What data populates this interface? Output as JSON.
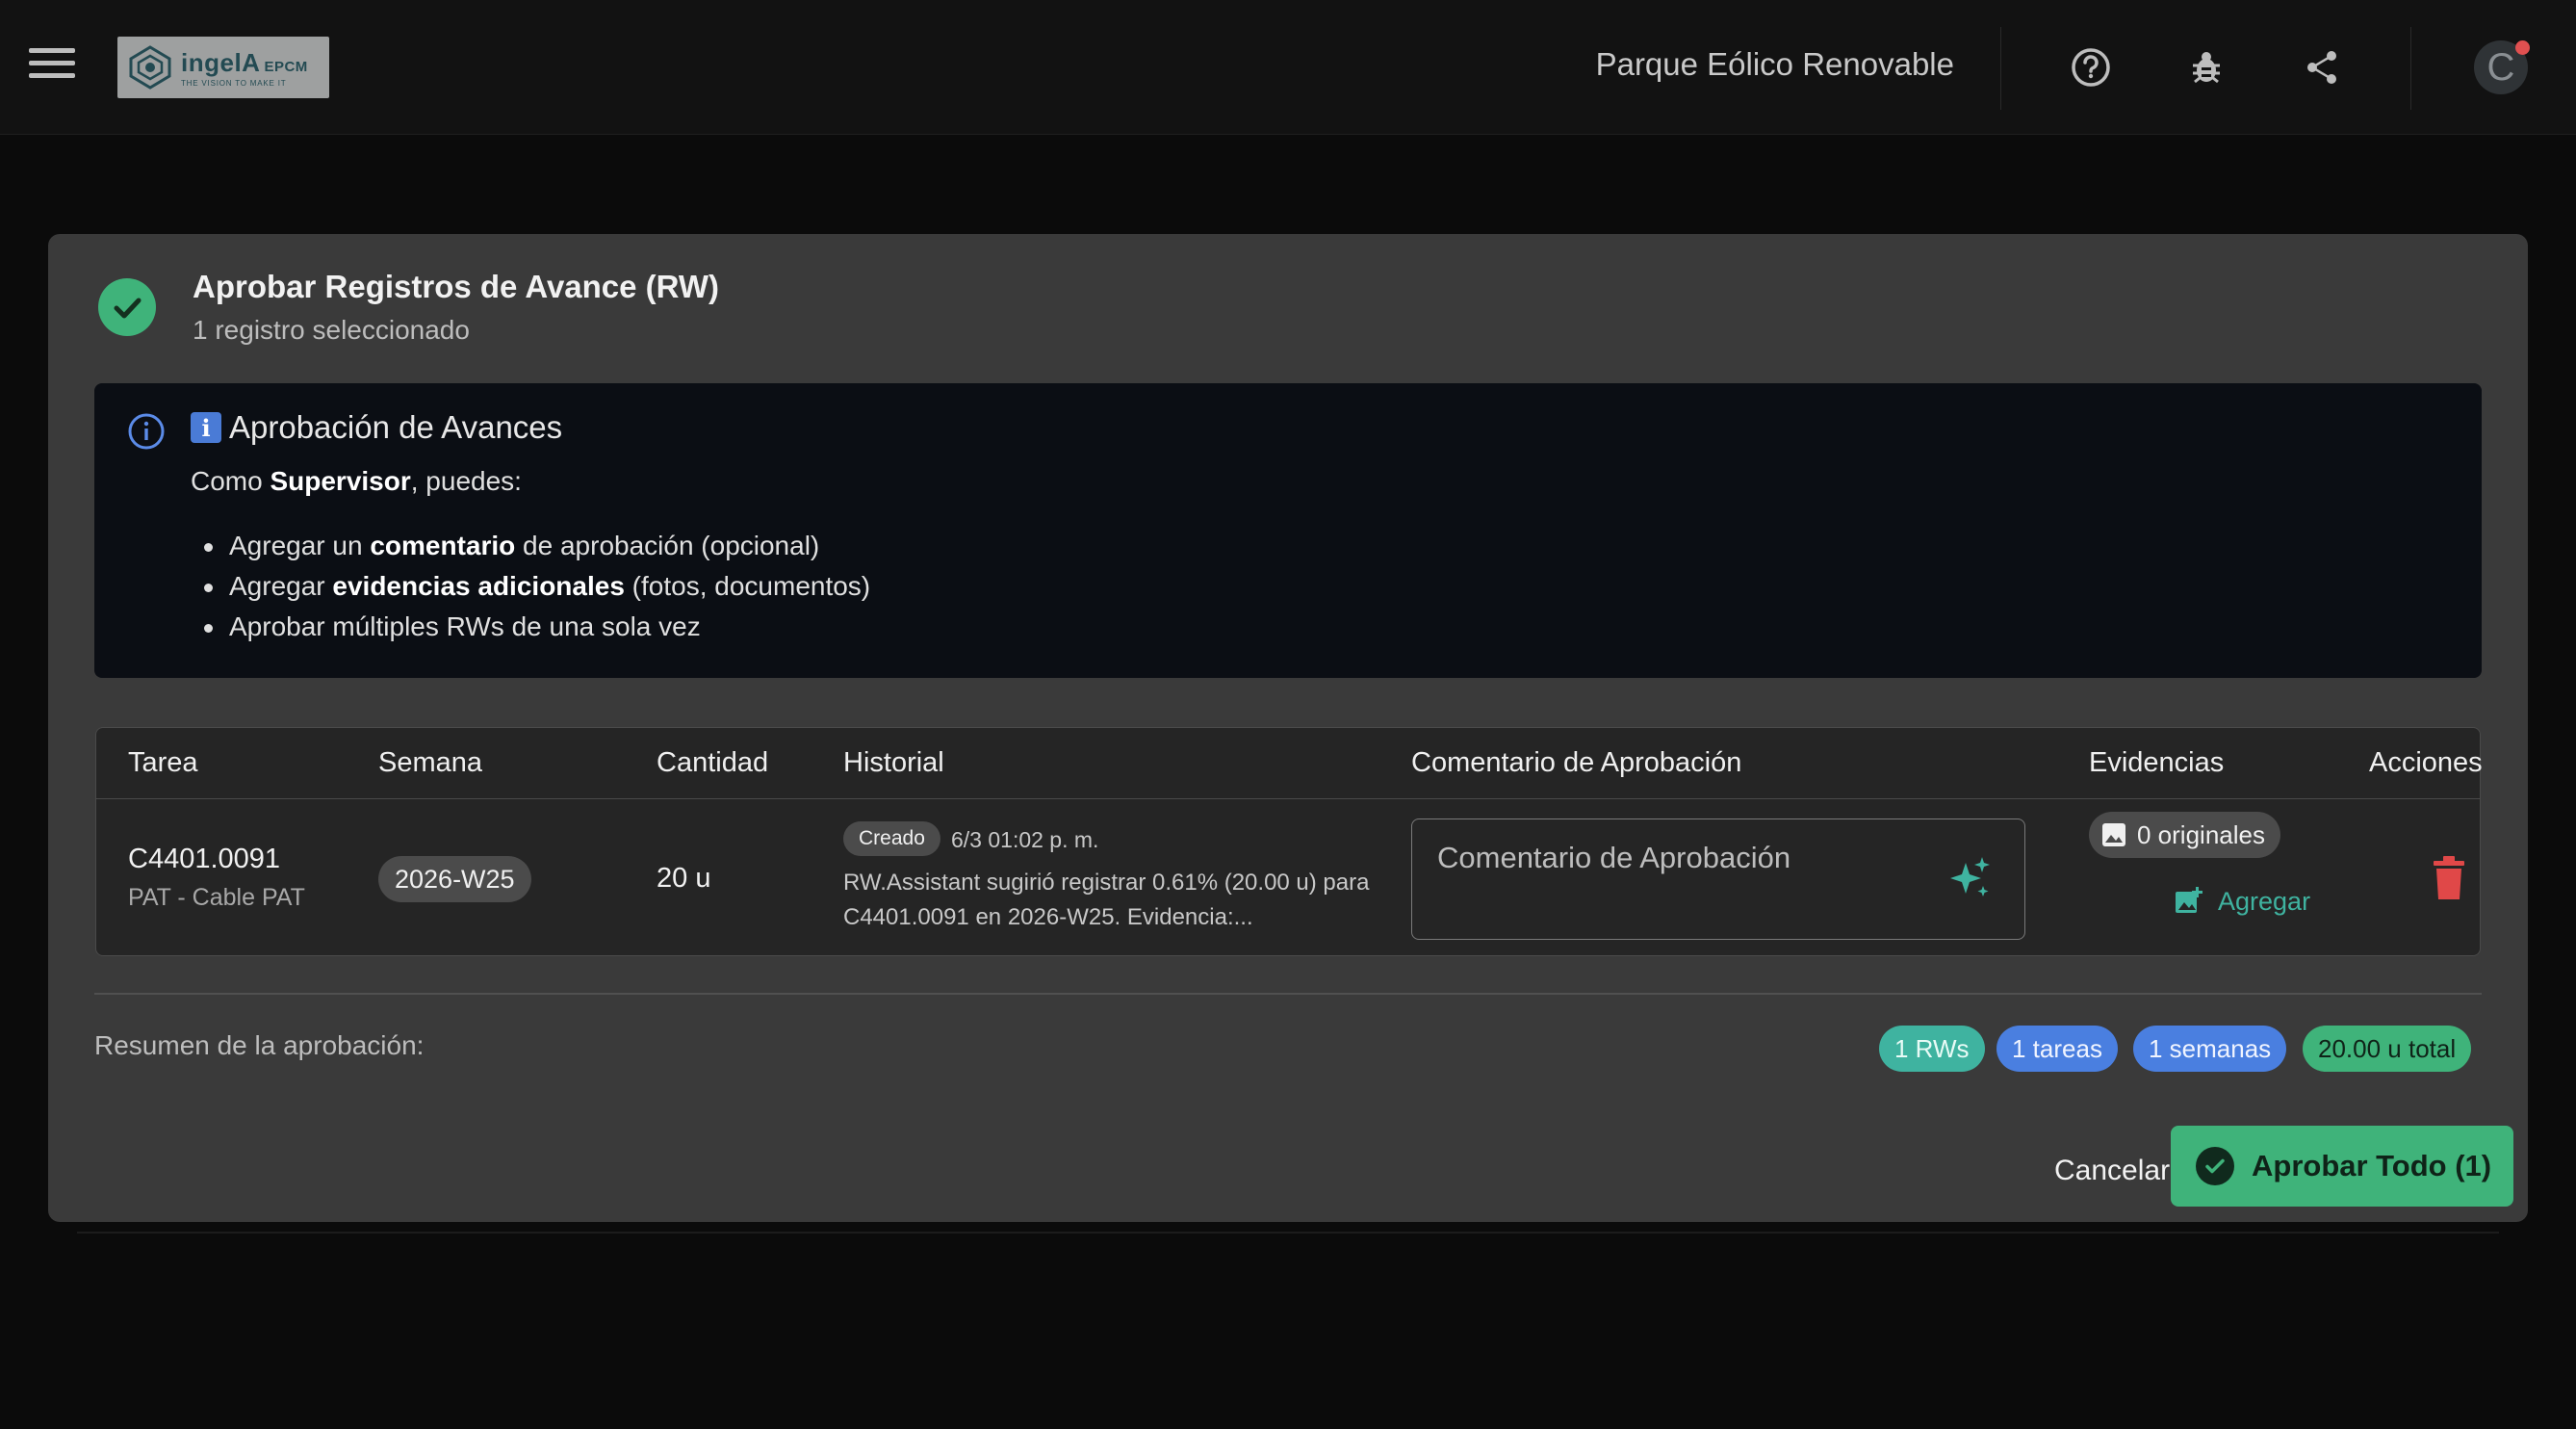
{
  "app": {
    "logo_text": "ingelA",
    "logo_suffix": "EPCM",
    "logo_tagline": "THE VISION TO MAKE IT",
    "project_title": "Parque Eólico Renovable",
    "avatar_initial": "C"
  },
  "dialog": {
    "title": "Aprobar Registros de Avance (RW)",
    "subtitle": "1 registro seleccionado",
    "info": {
      "title": "Aprobación de Avances",
      "emoji": "i",
      "intro_prefix": "Como ",
      "intro_role": "Supervisor",
      "intro_suffix": ", puedes:",
      "items": [
        {
          "prefix": "Agregar un ",
          "bold": "comentario",
          "suffix": " de aprobación (opcional)"
        },
        {
          "prefix": "Agregar ",
          "bold": "evidencias adicionales",
          "suffix": " (fotos, documentos)"
        },
        {
          "prefix": "Aprobar múltiples RWs de una sola vez",
          "bold": "",
          "suffix": ""
        }
      ]
    },
    "table": {
      "headers": [
        "Tarea",
        "Semana",
        "Cantidad",
        "Historial",
        "Comentario de Aprobación",
        "Evidencias",
        "Acciones"
      ],
      "rows": [
        {
          "task_code": "C4401.0091",
          "task_name": "PAT - Cable PAT",
          "week": "2026-W25",
          "quantity": "20 u",
          "history_status": "Creado",
          "history_date": "6/3 01:02 p. m.",
          "history_text": "RW.Assistant sugirió registrar 0.61% (20.00 u) para C4401.0091 en 2026-W25. Evidencia:...",
          "comment_placeholder": "Comentario de Aprobación",
          "comment_value": "",
          "evidence_count": "0 originales",
          "add_label": "Agregar"
        }
      ]
    },
    "summary": {
      "label": "Resumen de la aprobación:",
      "rws": "1 RWs",
      "tasks": "1 tareas",
      "weeks": "1 semanas",
      "total": "20.00 u total"
    },
    "buttons": {
      "cancel": "Cancelar",
      "approve": "Aprobar Todo (1)"
    }
  },
  "colors": {
    "accent_green": "#3fb37a",
    "accent_teal": "#3fb3a0",
    "accent_blue": "#4a7fe0",
    "danger": "#e04848"
  }
}
